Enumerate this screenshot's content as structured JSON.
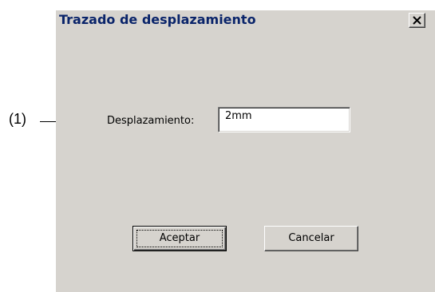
{
  "annotation": {
    "marker": "(1)"
  },
  "dialog": {
    "title": "Trazado de desplazamiento",
    "close_icon": "close-x-icon",
    "offset_field": {
      "label": "Desplazamiento:",
      "value": "2mm"
    },
    "buttons": {
      "accept_label": "Aceptar",
      "cancel_label": "Cancelar"
    }
  },
  "colors": {
    "dialog_face": "#d6d3ce",
    "title_text": "#0a246a",
    "input_background": "#ffffff"
  }
}
